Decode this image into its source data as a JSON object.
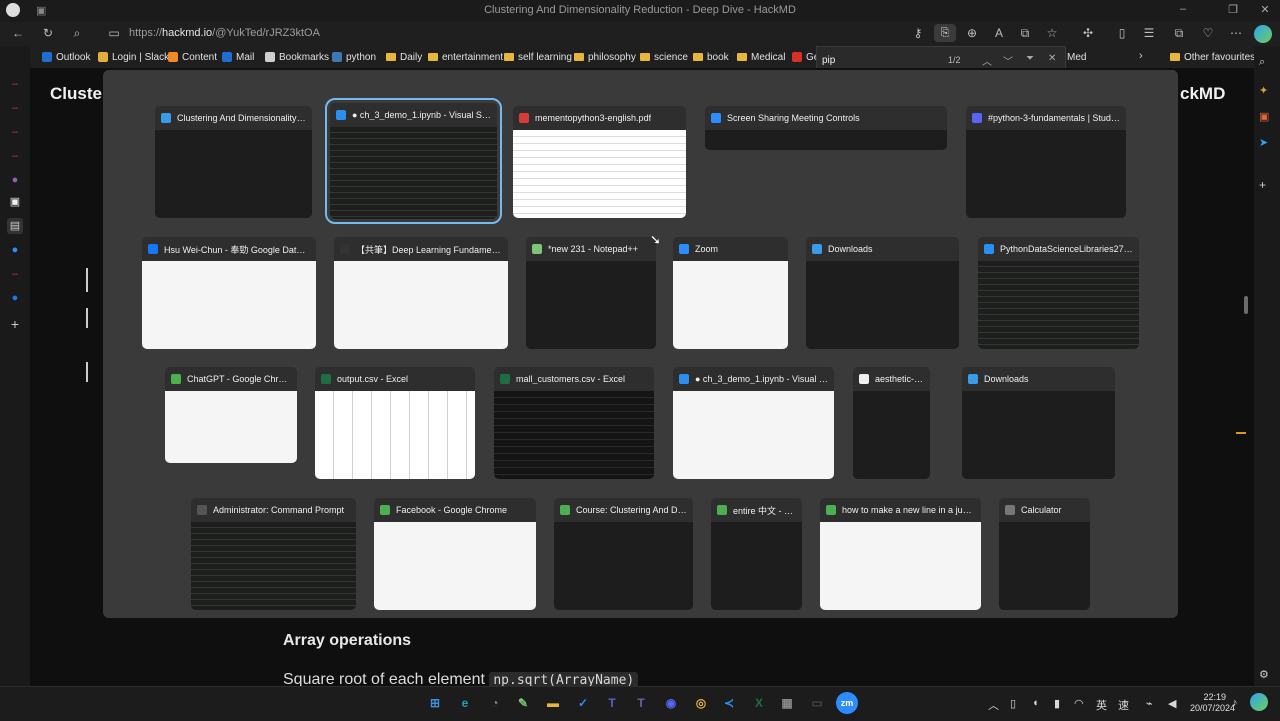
{
  "window": {
    "title": "Clustering And Dimensionality Reduction - Deep Dive - HackMD"
  },
  "address": {
    "url_prefix": "https://",
    "url_host": "hackmd.io",
    "url_path": "/@YukTed/rJRZ3ktOA"
  },
  "bookmarks": [
    {
      "label": "Outlook",
      "kind": "fav",
      "color": "#1f6fd1"
    },
    {
      "label": "Login | Slack",
      "kind": "fav",
      "color": "#e0b03a"
    },
    {
      "label": "Content",
      "kind": "fav",
      "color": "#f08a24"
    },
    {
      "label": "Mail",
      "kind": "fav",
      "color": "#1f6fd1"
    },
    {
      "label": "Bookmarks",
      "kind": "doc",
      "color": "#cfcfcf"
    },
    {
      "label": "python",
      "kind": "fav",
      "color": "#3d78b5"
    },
    {
      "label": "Daily",
      "kind": "folder"
    },
    {
      "label": "entertainment",
      "kind": "folder"
    },
    {
      "label": "self learning",
      "kind": "folder"
    },
    {
      "label": "philosophy",
      "kind": "folder"
    },
    {
      "label": "science",
      "kind": "folder"
    },
    {
      "label": "book",
      "kind": "folder"
    },
    {
      "label": "Medical",
      "kind": "folder"
    },
    {
      "label": "Ge",
      "kind": "fav",
      "color": "#d93025"
    }
  ],
  "bookmarks_tail": {
    "partial": "Med",
    "other": "Other favourites"
  },
  "find": {
    "query": "pip",
    "count": "1/2"
  },
  "page": {
    "heading_left": "Cluste",
    "heading_right": "ckMD",
    "array_heading": "Array operations",
    "sqrt_text": "Square root of each element",
    "sqrt_code": "np.sqrt(ArrayName)"
  },
  "switcher": {
    "rows": [
      [
        {
          "title": "Clustering And Dimensionality Red...",
          "icon": "#3a9be8",
          "thumb": "dark"
        },
        {
          "title": "● ch_3_demo_1.ipynb - Visual Stud...",
          "icon": "#2a8ff0",
          "thumb": "code",
          "selected": true
        },
        {
          "title": "mementopython3-english.pdf",
          "icon": "#d93a3a",
          "thumb": "doc"
        },
        {
          "title": "Screen Sharing Meeting Controls",
          "icon": "#2d8cff",
          "thumb": "dark"
        },
        {
          "title": "#python-3-fundamentals | Study C...",
          "icon": "#5865f2",
          "thumb": "dark"
        }
      ],
      [
        {
          "title": "Hsu Wei-Chun - 奉勁 Google Data An...",
          "icon": "#1877f2",
          "thumb": "light"
        },
        {
          "title": "【共筆】Deep Learning Fundamentals...",
          "icon": "#333333",
          "thumb": "light"
        },
        {
          "title": "*new 231 - Notepad++",
          "icon": "#7cc576",
          "thumb": "dark"
        },
        {
          "title": "Zoom",
          "icon": "#2d8cff",
          "thumb": "light"
        },
        {
          "title": "Downloads",
          "icon": "#3a9be8",
          "thumb": "dark"
        },
        {
          "title": "PythonDataScienceLibraries27to40...",
          "icon": "#2a8ff0",
          "thumb": "code"
        }
      ],
      [
        {
          "title": "ChatGPT - Google Chrome",
          "icon": "#4caf50",
          "thumb": "white"
        },
        {
          "title": "output.csv - Excel",
          "icon": "#1d6f42",
          "thumb": "sheet"
        },
        {
          "title": "mall_customers.csv - Excel",
          "icon": "#1d6f42",
          "thumb": "exceldark"
        },
        {
          "title": "● ch_3_demo_1.ipynb - Visual Stud...",
          "icon": "#2a8ff0",
          "thumb": "white"
        },
        {
          "title": "aesthetic-site-...",
          "icon": "#f0f0f0",
          "thumb": "dark"
        },
        {
          "title": "Downloads",
          "icon": "#3a9be8",
          "thumb": "dark"
        }
      ],
      [
        {
          "title": "Administrator: Command Prompt",
          "icon": "#555555",
          "thumb": "code"
        },
        {
          "title": "Facebook - Google Chrome",
          "icon": "#4caf50",
          "thumb": "light"
        },
        {
          "title": "Course: Clustering And Dim...",
          "icon": "#4caf50",
          "thumb": "dark"
        },
        {
          "title": "entire 中文 - G...",
          "icon": "#4caf50",
          "thumb": "dark"
        },
        {
          "title": "how to make a new line in a jupyt...",
          "icon": "#4caf50",
          "thumb": "white"
        },
        {
          "title": "Calculator",
          "icon": "#777777",
          "thumb": "dark"
        }
      ]
    ]
  },
  "taskbar": {
    "apps": [
      {
        "name": "windows-start-icon",
        "glyph": "⊞",
        "color": "#3b8fe0"
      },
      {
        "name": "edge-icon",
        "glyph": "e",
        "color": "#1aa3b8"
      },
      {
        "name": "clock-app-icon",
        "glyph": "◔",
        "color": "#8a8a8a"
      },
      {
        "name": "notepadpp-icon",
        "glyph": "✎",
        "color": "#7cc576"
      },
      {
        "name": "file-explorer-icon",
        "glyph": "▬",
        "color": "#e7b73b"
      },
      {
        "name": "bluetooth-share-icon",
        "glyph": "✓",
        "color": "#2a8ff0"
      },
      {
        "name": "teams-icon",
        "glyph": "T",
        "color": "#5b5fc7"
      },
      {
        "name": "teams-alt-icon",
        "glyph": "T",
        "color": "#6264a7"
      },
      {
        "name": "discord-icon",
        "glyph": "◉",
        "color": "#5865f2"
      },
      {
        "name": "chrome-icon",
        "glyph": "◎",
        "color": "#e0b03a"
      },
      {
        "name": "vscode-icon",
        "glyph": "≺",
        "color": "#2a8ff0"
      },
      {
        "name": "excel-icon",
        "glyph": "X",
        "color": "#1d6f42"
      },
      {
        "name": "calculator-icon",
        "glyph": "▦",
        "color": "#8a8a8a"
      },
      {
        "name": "terminal-icon",
        "glyph": "▭",
        "color": "#444444"
      },
      {
        "name": "zoom-icon",
        "glyph": "zm",
        "color": "#2d8cff"
      }
    ],
    "time": "22:19",
    "date": "20/07/2024",
    "ime_1": "英",
    "ime_2": "速"
  }
}
